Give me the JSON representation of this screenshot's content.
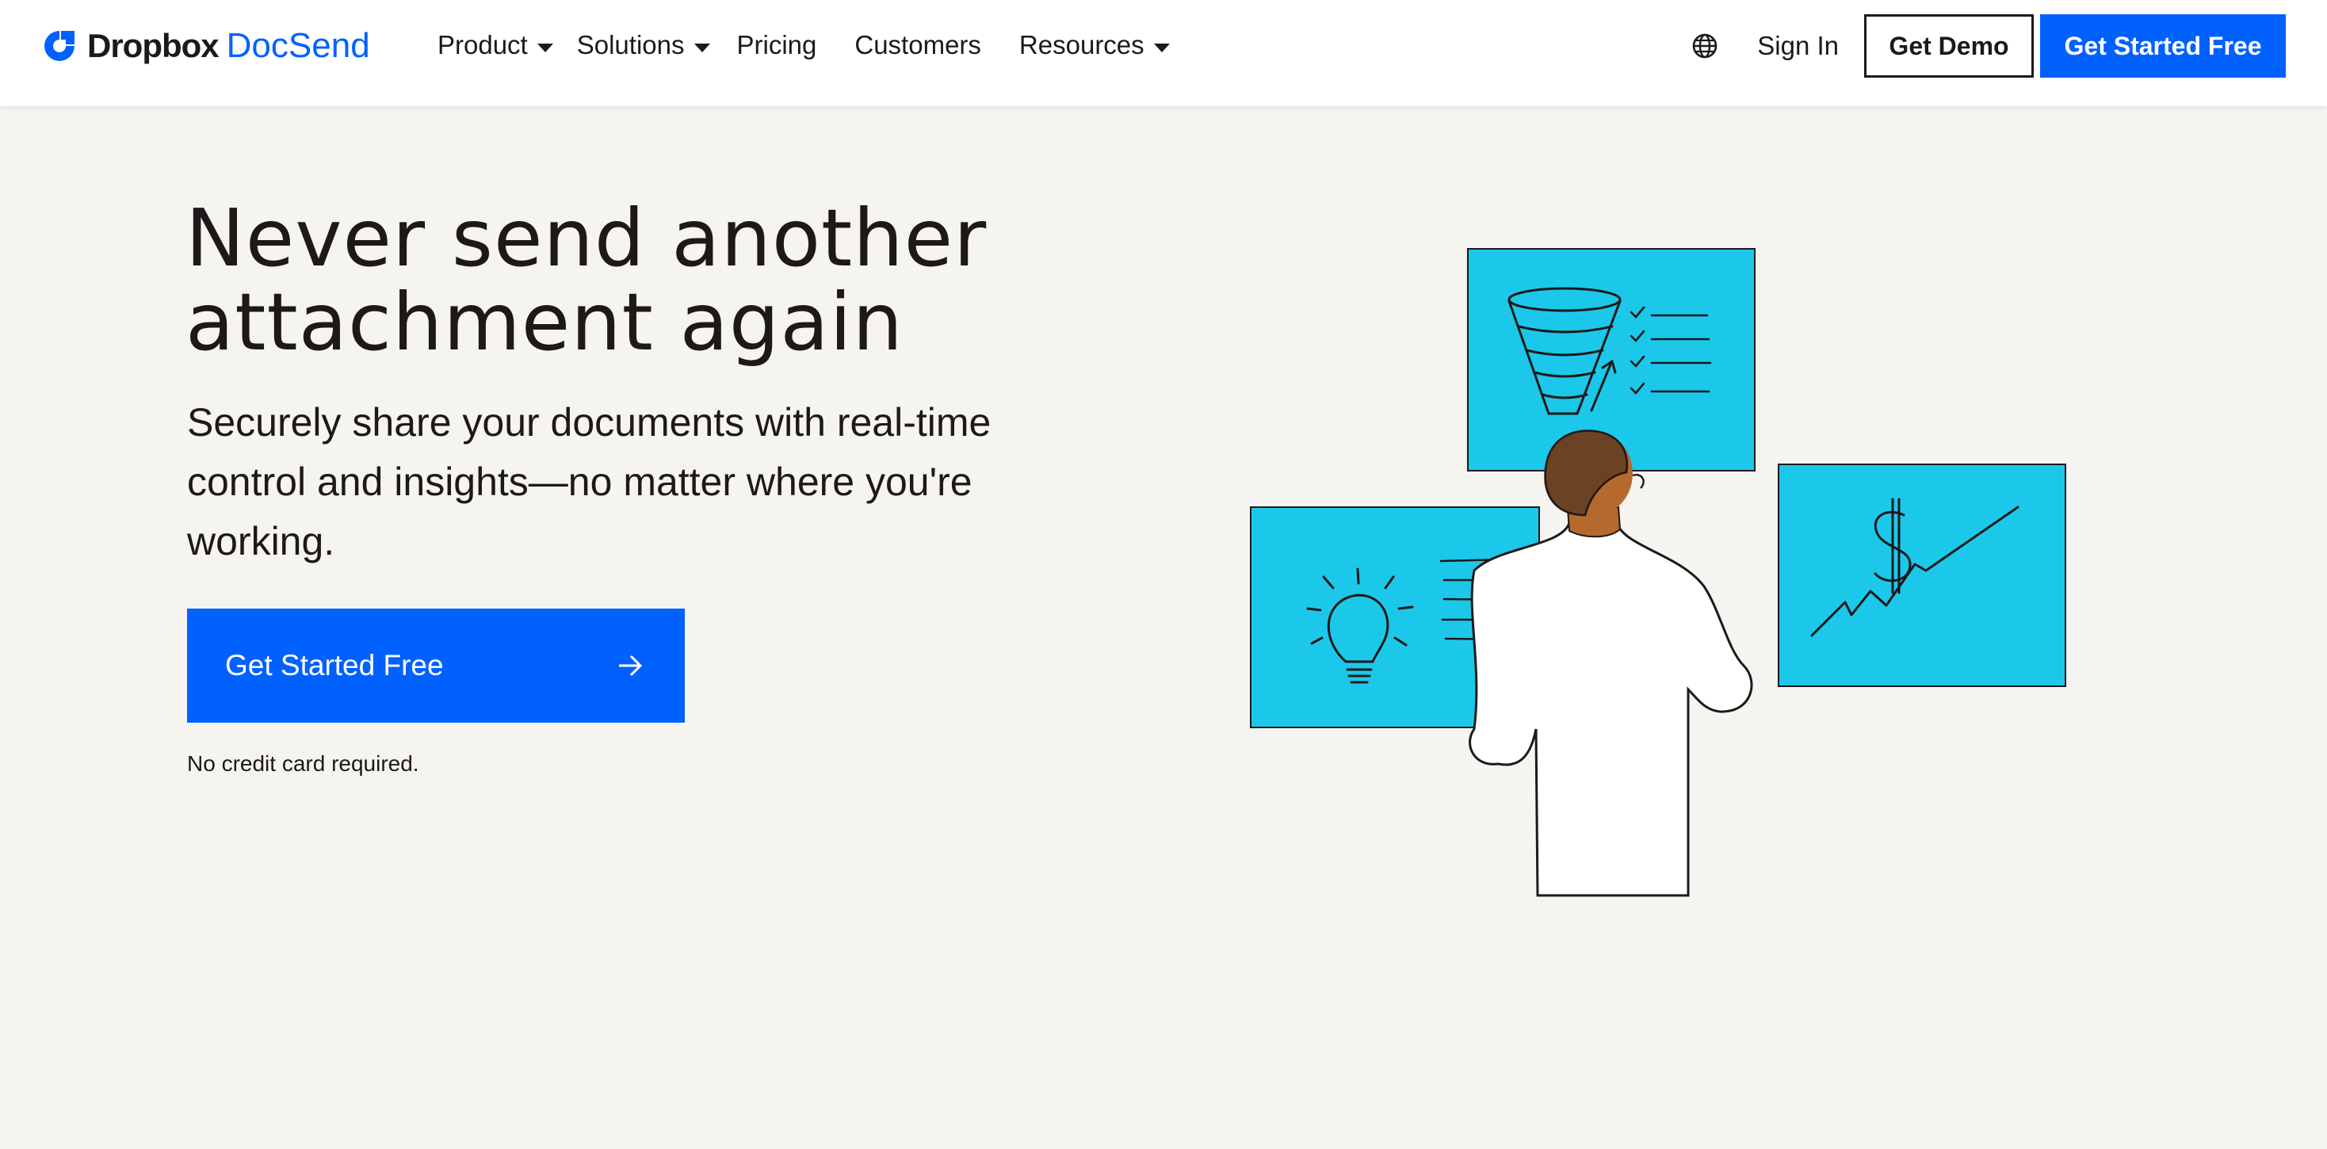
{
  "brand": {
    "name_primary": "Dropbox",
    "name_secondary": "DocSend",
    "accent_color": "#0061fe",
    "illustration_panel_color": "#1cc8ea"
  },
  "nav": {
    "items": [
      {
        "label": "Product",
        "has_dropdown": true
      },
      {
        "label": "Solutions",
        "has_dropdown": true
      },
      {
        "label": "Pricing",
        "has_dropdown": false
      },
      {
        "label": "Customers",
        "has_dropdown": false
      },
      {
        "label": "Resources",
        "has_dropdown": true
      }
    ],
    "language_icon": "globe-icon",
    "sign_in": "Sign In",
    "get_demo": "Get Demo",
    "get_started": "Get Started Free"
  },
  "hero": {
    "headline": "Never send another attachment again",
    "subtext": "Securely share your documents with real-time control and insights—no matter where you're working.",
    "cta_label": "Get Started Free",
    "cta_icon": "arrow-right-icon",
    "note": "No credit card required."
  }
}
